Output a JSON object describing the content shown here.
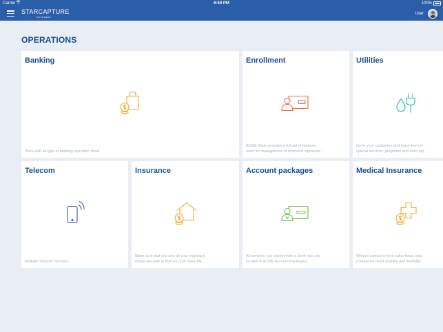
{
  "status_bar": {
    "carrier": "Carrier",
    "time": "6:50 PM",
    "battery": "100%"
  },
  "header": {
    "logo_main": "STARCAPTURE",
    "logo_sub": "ANYWHERE",
    "user_label": "User"
  },
  "section_title": "OPERATIONS",
  "colors": {
    "nav": "#2a5ea8",
    "orange": "#f5a623",
    "red": "#f0663c",
    "teal": "#2ab8b0",
    "blue": "#2a5ea8",
    "green": "#6bbd45",
    "title": "#1d4f8f"
  },
  "cards": [
    {
      "title": "Banking",
      "icon": "banking-icon",
      "desc1": "Work with all type of banking operation flows",
      "desc2": ""
    },
    {
      "title": "Enrollment",
      "icon": "enrollment-id-card-icon",
      "desc1": "ACME Bank provides a full set of features",
      "desc2": "used for management of biometric signature..."
    },
    {
      "title": "Utilities",
      "icon": "utilities-water-plug-icon",
      "desc1": "Go to your customers and enrol them in",
      "desc2": "special services, programs and even sig"
    },
    {
      "title": "Telecom",
      "icon": "telecom-phone-icon",
      "desc1": "Multiple Telecom Services",
      "desc2": ""
    },
    {
      "title": "Insurance",
      "icon": "insurance-house-coins-icon",
      "desc1": "Make sure that you and all your important",
      "desc2": "things are safe to that you can enjoy life"
    },
    {
      "title": "Account packages",
      "icon": "account-packages-card-icon",
      "desc1": "All services you expect from a bank now are",
      "desc2": "located in ACME Account Packages!..."
    },
    {
      "title": "Medical Insurance",
      "icon": "medical-cross-coins-icon",
      "desc1": "When it comes to their sales force, insu",
      "desc2": "companies need mobility and flexibility"
    }
  ]
}
